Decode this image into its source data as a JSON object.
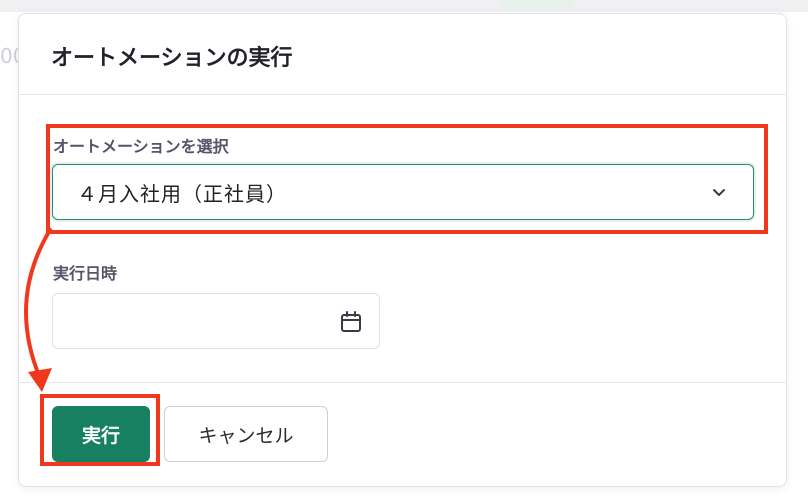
{
  "background": {
    "ghost_text": "00"
  },
  "modal": {
    "title": "オートメーションの実行",
    "automation_field": {
      "label": "オートメーションを選択",
      "selected_value": "４月入社用（正社員）"
    },
    "datetime_field": {
      "label": "実行日時",
      "value": ""
    },
    "buttons": {
      "run_label": "実行",
      "cancel_label": "キャンセル"
    }
  },
  "colors": {
    "primary": "#168061",
    "focus_border": "#2a8a6e",
    "annotation": "#f0381c"
  }
}
